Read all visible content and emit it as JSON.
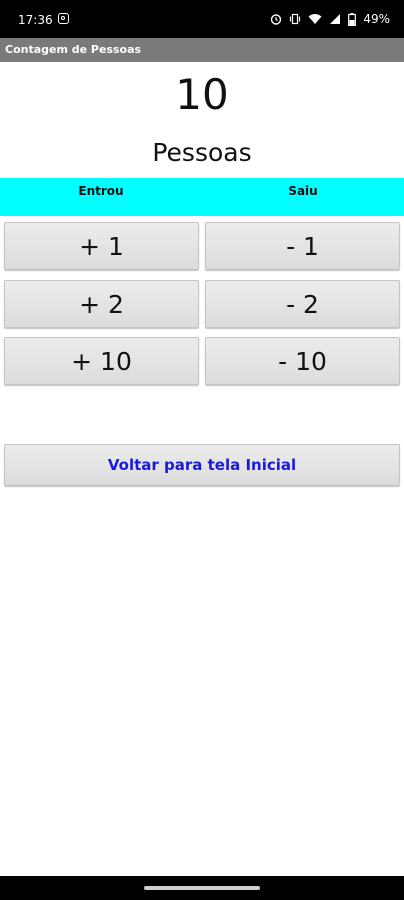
{
  "status_bar": {
    "time": "17:36",
    "battery_text": "49%",
    "icons": [
      "instagram-icon",
      "alarm-icon",
      "vibrate-icon",
      "wifi-icon",
      "signal-icon",
      "battery-icon"
    ]
  },
  "app_bar": {
    "title": "Contagem de Pessoas"
  },
  "counter": {
    "value": "10",
    "label": "Pessoas"
  },
  "columns": {
    "entrou": "Entrou",
    "saiu": "Saiu",
    "band_color": "#00ffff"
  },
  "buttons": {
    "plus_1": "+ 1",
    "minus_1": "- 1",
    "plus_2": "+ 2",
    "minus_2": "- 2",
    "plus_10": "+ 10",
    "minus_10": "- 10"
  },
  "back_button": {
    "label": "Voltar para tela Inicial",
    "color": "#1a1adc"
  }
}
